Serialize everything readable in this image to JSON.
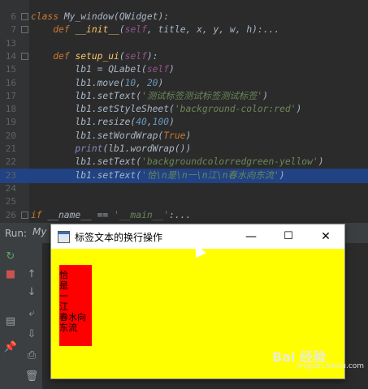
{
  "editor": {
    "lines": [
      {
        "num": "6",
        "segs": [
          [
            "k",
            "class "
          ],
          [
            "t",
            "My_window"
          ],
          [
            "t",
            "(QWidget):"
          ]
        ]
      },
      {
        "num": "7",
        "segs": [
          [
            "t",
            "    "
          ],
          [
            "k",
            "def "
          ],
          [
            "f",
            "__init__"
          ],
          [
            "t",
            "("
          ],
          [
            "p",
            "self"
          ],
          [
            "t",
            ", title, x, y, w, h):"
          ],
          [
            "t",
            "..."
          ]
        ]
      },
      {
        "num": "13",
        "segs": [
          [
            "t",
            ""
          ]
        ]
      },
      {
        "num": "14",
        "segs": [
          [
            "t",
            "    "
          ],
          [
            "k",
            "def "
          ],
          [
            "f",
            "setup_ui"
          ],
          [
            "t",
            "("
          ],
          [
            "p",
            "self"
          ],
          [
            "t",
            "):"
          ]
        ]
      },
      {
        "num": "15",
        "segs": [
          [
            "t",
            "        lb1 = "
          ],
          [
            "t",
            "QLabel("
          ],
          [
            "p",
            "self"
          ],
          [
            "t",
            ")"
          ]
        ]
      },
      {
        "num": "16",
        "segs": [
          [
            "t",
            "        lb1.move("
          ],
          [
            "n",
            "10"
          ],
          [
            "t",
            ", "
          ],
          [
            "n",
            "20"
          ],
          [
            "t",
            ")"
          ]
        ]
      },
      {
        "num": "17",
        "segs": [
          [
            "t",
            "        lb1.setText("
          ],
          [
            "s",
            "'测试标签测试标签测试标签'"
          ],
          [
            "t",
            ")"
          ]
        ]
      },
      {
        "num": "18",
        "segs": [
          [
            "t",
            "        lb1.setStyleSheet("
          ],
          [
            "s",
            "'background-color:red'"
          ],
          [
            "t",
            ")"
          ]
        ]
      },
      {
        "num": "19",
        "segs": [
          [
            "t",
            "        lb1.resize("
          ],
          [
            "n",
            "40"
          ],
          [
            "t",
            ","
          ],
          [
            "n",
            "100"
          ],
          [
            "t",
            ")"
          ]
        ]
      },
      {
        "num": "20",
        "segs": [
          [
            "t",
            "        lb1.setWordWrap("
          ],
          [
            "k",
            "True"
          ],
          [
            "t",
            ")"
          ]
        ]
      },
      {
        "num": "21",
        "segs": [
          [
            "t",
            "        "
          ],
          [
            "b",
            "print"
          ],
          [
            "t",
            "(lb1.wordWrap())"
          ]
        ]
      },
      {
        "num": "22",
        "segs": [
          [
            "t",
            "        lb1.setText("
          ],
          [
            "s",
            "'backgroundcolorredgreen-yellow'"
          ],
          [
            "t",
            ")"
          ]
        ]
      },
      {
        "num": "23",
        "segs": [
          [
            "t",
            "        lb1.setText("
          ],
          [
            "s",
            "'恰\\n是\\n一\\n江\\n春水向东流'"
          ],
          [
            "t",
            ")"
          ]
        ]
      },
      {
        "num": "24",
        "segs": [
          [
            "t",
            ""
          ]
        ]
      },
      {
        "num": "25",
        "segs": [
          [
            "t",
            ""
          ]
        ]
      },
      {
        "num": "26",
        "segs": [
          [
            "k",
            "if "
          ],
          [
            "t",
            "__name__ == "
          ],
          [
            "s",
            "'__main__'"
          ],
          [
            "t",
            ":..."
          ]
        ]
      }
    ]
  },
  "run": {
    "label": "Run:",
    "tab": "My"
  },
  "qt_window": {
    "title": "标签文本的换行操作",
    "minimize": "—",
    "maximize": "☐",
    "close": "✕",
    "label_text": "恰\n是\n一\n江\n春水向\n东流"
  },
  "watermark": {
    "brand": "Bai 经验",
    "url": "jingyan.baidu.com"
  },
  "colors": {
    "window_bg": "#ffff00",
    "label_bg": "#ff0000",
    "editor_bg": "#2b2b2b",
    "selection": "#214283"
  }
}
